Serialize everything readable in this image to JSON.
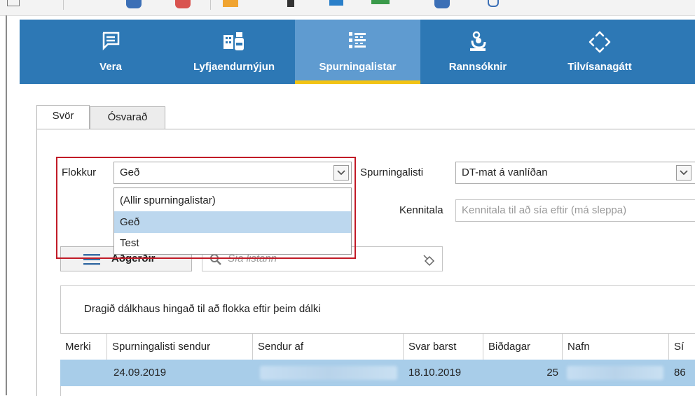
{
  "nav": {
    "items": [
      {
        "label": "Vera",
        "icon": "message-icon"
      },
      {
        "label": "Lyfjaendurnýjun",
        "icon": "medicine-icon"
      },
      {
        "label": "Spurningalistar",
        "icon": "checklist-icon",
        "active": true
      },
      {
        "label": "Rannsóknir",
        "icon": "microscope-icon"
      },
      {
        "label": "Tilvísanagátt",
        "icon": "portal-icon"
      }
    ],
    "active_color": "#f2c314",
    "bar_color": "#2d78b5"
  },
  "tabs": [
    {
      "label": "Svör",
      "active": true
    },
    {
      "label": "Ósvarað",
      "active": false
    }
  ],
  "form": {
    "category_label": "Flokkur",
    "category_value": "Geð",
    "questionnaire_label": "Spurningalisti",
    "questionnaire_value": "DT-mat á vanlíðan",
    "ssn_label": "Kennitala",
    "ssn_placeholder": "Kennitala til að sía eftir (má sleppa)"
  },
  "dropdown": {
    "options": [
      "(Allir spurningalistar)",
      "Geð",
      "Test"
    ],
    "selected": "Geð"
  },
  "actions": {
    "button_label": "Aðgerðir",
    "search_placeholder": "Sía listann"
  },
  "grid": {
    "group_hint": "Dragið dálkhaus hingað til að flokka eftir þeim dálki",
    "columns": [
      "Merki",
      "Spurningalisti sendur",
      "Sendur af",
      "Svar barst",
      "Biðdagar",
      "Nafn",
      "Sí"
    ],
    "rows": [
      {
        "merki": "",
        "sent": "24.09.2019",
        "sent_by": "",
        "answered": "18.10.2019",
        "wait_days": "25",
        "name": "",
        "phone": "86"
      }
    ]
  }
}
